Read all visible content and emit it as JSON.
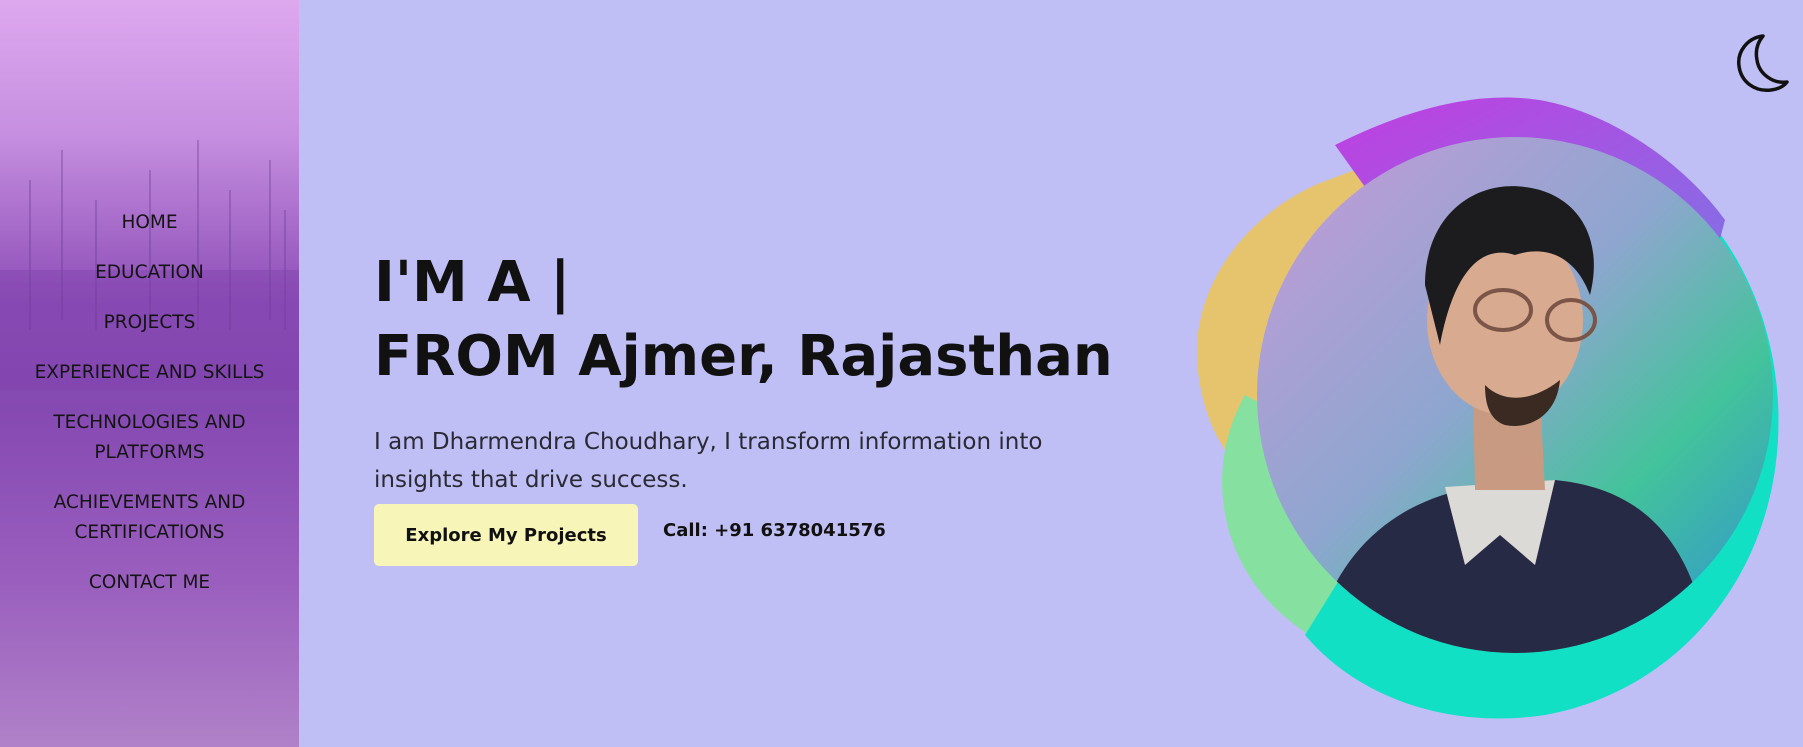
{
  "sidebar": {
    "items": [
      {
        "label": "HOME"
      },
      {
        "label": "EDUCATION"
      },
      {
        "label": "PROJECTS"
      },
      {
        "label": "EXPERIENCE AND SKILLS"
      },
      {
        "label": "TECHNOLOGIES AND PLATFORMS"
      },
      {
        "label": "ACHIEVEMENTS AND CERTIFICATIONS"
      },
      {
        "label": "CONTACT ME"
      }
    ]
  },
  "theme_toggle": {
    "icon": "moon-icon"
  },
  "hero": {
    "title_line1": "I'M A |",
    "title_line2": "FROM Ajmer, Rajasthan",
    "description": "I am Dharmendra Choudhary, I transform information into insights that drive success.",
    "cta_label": "Explore My Projects",
    "call_text": "Call: +91 6378041576"
  },
  "colors": {
    "page_bg": "#bfbff5",
    "cta_bg": "#f7f6b8",
    "blob_purple": "#c13ee0",
    "blob_teal": "#12e0c4",
    "blob_green": "#86e0a0",
    "blob_yellow": "#e6c46e"
  }
}
